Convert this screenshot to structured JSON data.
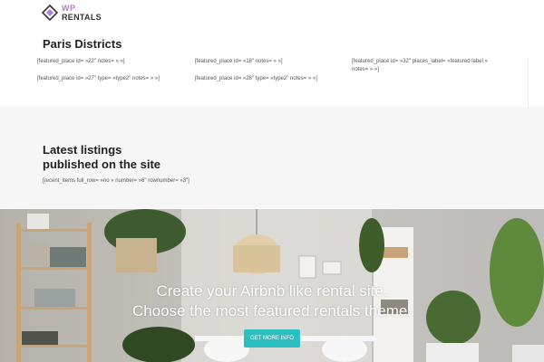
{
  "header": {
    "logo_line1": "WP",
    "logo_line2": "RENTALS"
  },
  "districts": {
    "title": "Paris Districts",
    "shortcodes": [
      "[featured_place id= »22\" notes= » »]",
      "[featured_place id= »18\" notes= » »]",
      "[featured_place id= »32\" places_label= »featured label » notes= » »]",
      "[featured_place id= »27\" type= »type2\" notes= » »]",
      "[featured_place id= »28\" type= »type2\" notes= » »]"
    ]
  },
  "listings": {
    "title_line1": "Latest listings",
    "title_line2": "published on the site",
    "shortcode": "[recent_items full_row= »no » number= »6\" rownumber= »3\"]"
  },
  "hero": {
    "line1": "Create your Airbnb like rental site.",
    "line2": "Choose the most featured rentals theme.",
    "button_label": "GET MORE INFO"
  },
  "colors": {
    "accent": "#2bc0bf",
    "logo_purple": "#b07cd8",
    "band_bg": "#f6f6f7"
  }
}
